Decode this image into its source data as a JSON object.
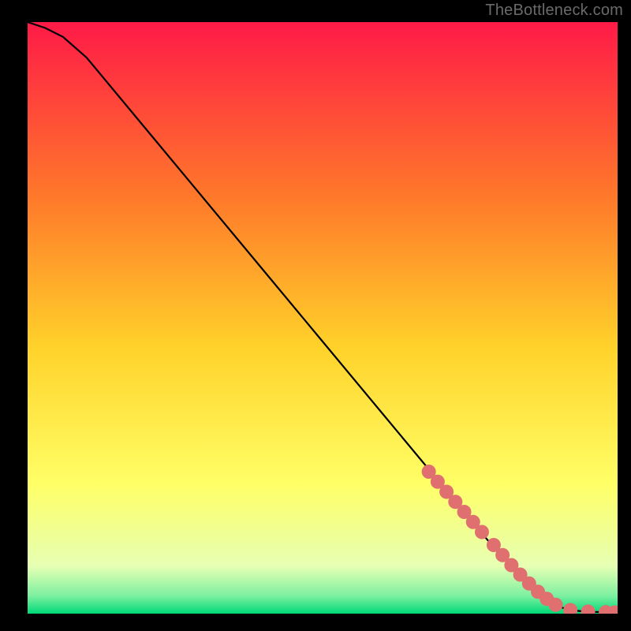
{
  "attribution": "TheBottleneck.com",
  "colors": {
    "gradient_top": "#ff1a47",
    "gradient_mid1": "#ff7a2a",
    "gradient_mid2": "#ffd22a",
    "gradient_mid3": "#ffff66",
    "gradient_mid4": "#e6ffb3",
    "gradient_mid5": "#7cf0a0",
    "gradient_bottom": "#00d978",
    "curve": "#000000",
    "marker": "#e07070"
  },
  "chart_data": {
    "type": "line",
    "title": "",
    "xlabel": "",
    "ylabel": "",
    "xlim": [
      0,
      100
    ],
    "ylim": [
      0,
      100
    ],
    "series": [
      {
        "name": "bottleneck-curve",
        "x": [
          0,
          3,
          6,
          10,
          15,
          20,
          30,
          40,
          50,
          60,
          70,
          80,
          85,
          88,
          90,
          92,
          94,
          96,
          98,
          100
        ],
        "y": [
          100,
          99,
          97.5,
          94,
          88,
          82,
          70,
          58,
          46,
          34,
          22,
          10,
          5,
          2.5,
          1.2,
          0.6,
          0.4,
          0.3,
          0.25,
          0.2
        ]
      }
    ],
    "markers": {
      "name": "highlighted-region",
      "x": [
        68,
        69.5,
        71,
        72.5,
        74,
        75.5,
        77,
        79,
        80.5,
        82,
        83.5,
        85,
        86.5,
        88,
        89.5,
        92,
        95,
        98,
        99.5
      ],
      "y": [
        24,
        22.3,
        20.6,
        18.9,
        17.2,
        15.5,
        13.8,
        11.6,
        9.9,
        8.2,
        6.6,
        5.1,
        3.7,
        2.5,
        1.5,
        0.6,
        0.35,
        0.25,
        0.2
      ]
    }
  }
}
